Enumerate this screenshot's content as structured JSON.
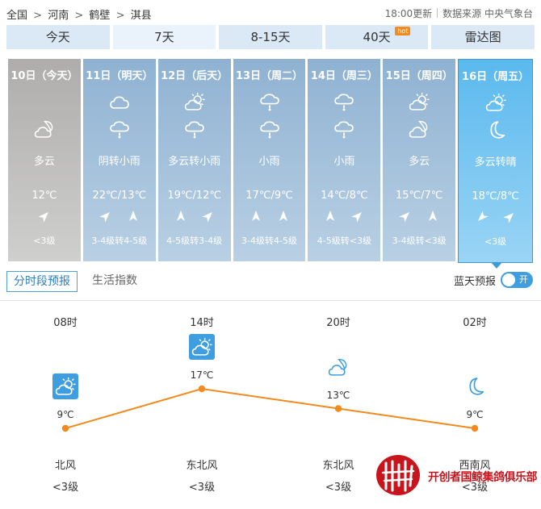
{
  "breadcrumb": [
    "全国",
    "河南",
    "鹤壁",
    "淇县"
  ],
  "breadcrumb_sep": ">",
  "update_time": "18:00更新",
  "data_source": "数据来源 中央气象台",
  "tabs": [
    {
      "label": "今天",
      "active": false
    },
    {
      "label": "7天",
      "active": true
    },
    {
      "label": "8-15天",
      "active": false
    },
    {
      "label": "40天",
      "active": false,
      "badge": "hot"
    },
    {
      "label": "雷达图",
      "active": false
    }
  ],
  "days": [
    {
      "date": "10日（今天）",
      "icons": [
        "cloudy-night-icon"
      ],
      "desc": "多云",
      "temp": "12℃",
      "winds": [
        "ne"
      ],
      "level": "<3级",
      "state": "past"
    },
    {
      "date": "11日（明天）",
      "icons": [
        "cloud-icon",
        "light-rain-icon"
      ],
      "desc": "阴转小雨",
      "temp": "22℃/13℃",
      "winds": [
        "ne",
        "n"
      ],
      "level": "3-4级转4-5级",
      "state": "normal"
    },
    {
      "date": "12日（后天）",
      "icons": [
        "partly-cloudy-icon",
        "light-rain-icon"
      ],
      "desc": "多云转小雨",
      "temp": "19℃/12℃",
      "winds": [
        "n",
        "ne"
      ],
      "level": "4-5级转3-4级",
      "state": "normal"
    },
    {
      "date": "13日（周二）",
      "icons": [
        "light-rain-icon",
        "light-rain-icon"
      ],
      "desc": "小雨",
      "temp": "17℃/9℃",
      "winds": [
        "n",
        "n"
      ],
      "level": "3-4级转4-5级",
      "state": "normal"
    },
    {
      "date": "14日（周三）",
      "icons": [
        "light-rain-icon",
        "light-rain-icon"
      ],
      "desc": "小雨",
      "temp": "14℃/8℃",
      "winds": [
        "n",
        "ne"
      ],
      "level": "4-5级转<3级",
      "state": "normal"
    },
    {
      "date": "15日（周四）",
      "icons": [
        "partly-cloudy-icon",
        "cloudy-night-icon"
      ],
      "desc": "多云",
      "temp": "15℃/7℃",
      "winds": [
        "ne",
        "n"
      ],
      "level": "3-4级转<3级",
      "state": "normal"
    },
    {
      "date": "16日（周五）",
      "icons": [
        "partly-cloudy-icon",
        "moon-icon"
      ],
      "desc": "多云转晴",
      "temp": "18℃/8℃",
      "winds": [
        "sw",
        "ne"
      ],
      "level": "<3级",
      "state": "selected"
    }
  ],
  "subtabs": [
    {
      "label": "分时段预报",
      "active": true
    },
    {
      "label": "生活指数",
      "active": false
    }
  ],
  "toggle": {
    "label": "蓝天预报",
    "state_label": "开",
    "on": true
  },
  "hourly": [
    {
      "time": "08时",
      "temp": 9,
      "temp_label": "9℃",
      "icon": "partly-cloudy-icon",
      "wind": "北风",
      "level": "<3级"
    },
    {
      "time": "14时",
      "temp": 17,
      "temp_label": "17℃",
      "icon": "partly-cloudy-icon",
      "wind": "东北风",
      "level": "<3级"
    },
    {
      "time": "20时",
      "temp": 13,
      "temp_label": "13℃",
      "icon": "cloudy-night-icon",
      "wind": "东北风",
      "level": "<3级"
    },
    {
      "time": "02时",
      "temp": 9,
      "temp_label": "9℃",
      "icon": "moon-icon",
      "wind": "西南风",
      "level": "<3级"
    }
  ],
  "watermark": {
    "text": "开创者国鲸集鸽俱乐部"
  },
  "colors": {
    "line": "#f28a1d",
    "accent": "#3f9ee0",
    "icon_blue": "#3f9ee0",
    "watermark": "#c8151d"
  }
}
